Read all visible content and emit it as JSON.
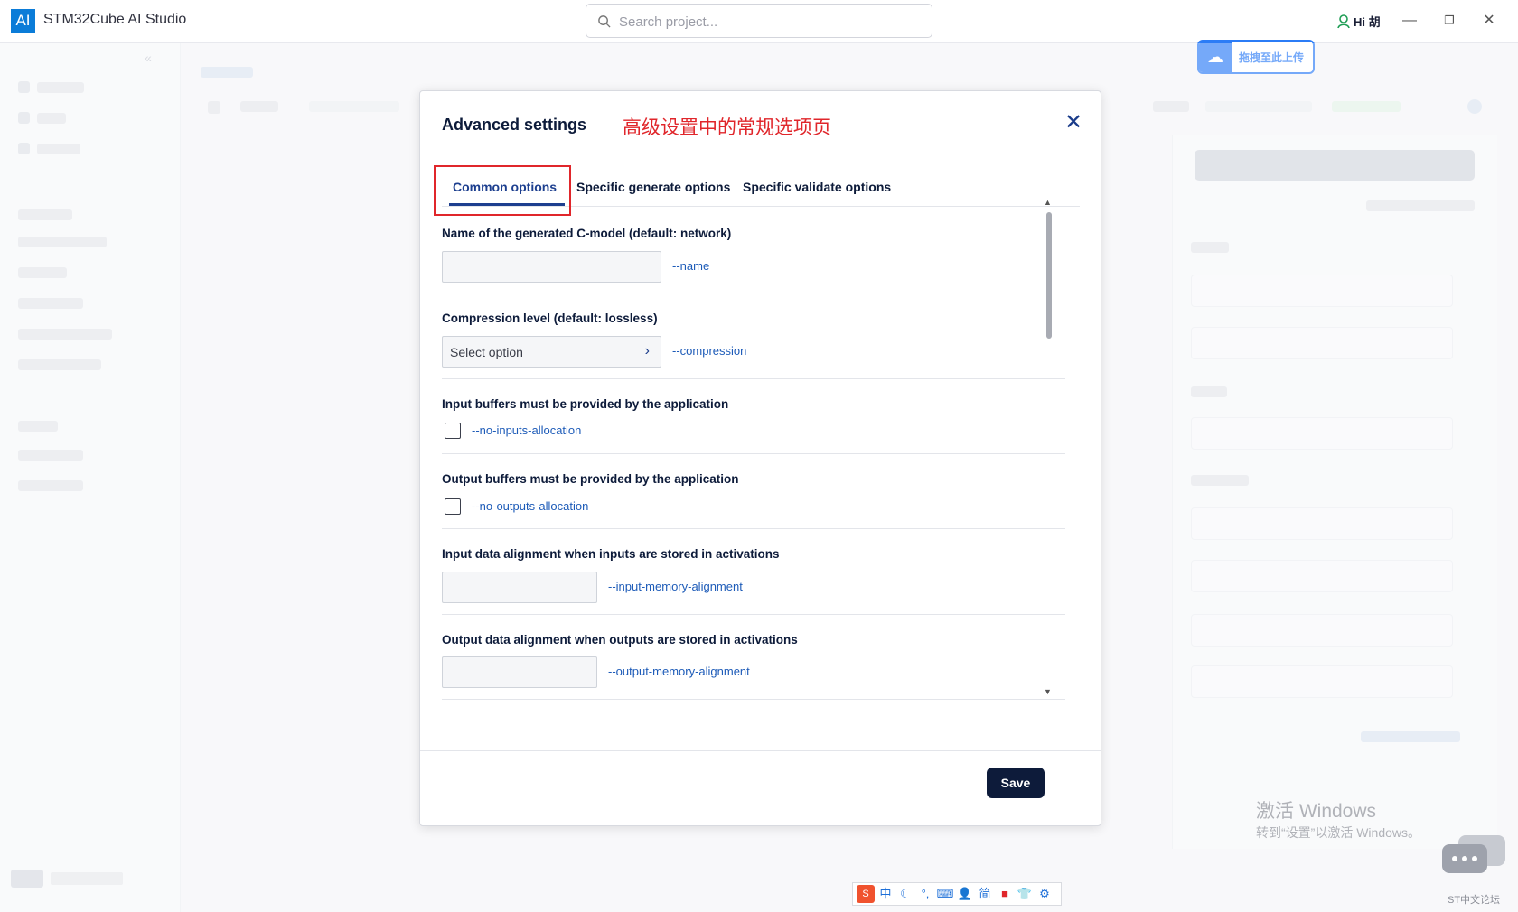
{
  "app": {
    "logo_text": "AI",
    "title": "STM32Cube AI Studio",
    "search_placeholder": "Search project...",
    "user_greeting": "Hi 胡",
    "upload_badge": "拖拽至此上传"
  },
  "modal": {
    "title": "Advanced settings",
    "annotation": "高级设置中的常规选项页",
    "close_symbol": "✕",
    "tabs": [
      {
        "label": "Common options",
        "active": true
      },
      {
        "label": "Specific generate options",
        "active": false
      },
      {
        "label": "Specific validate options",
        "active": false
      }
    ],
    "sections": [
      {
        "label": "Name of the generated C-model (default: network)",
        "type": "text",
        "value": "",
        "flag": "--name"
      },
      {
        "label": "Compression level (default: lossless)",
        "type": "select",
        "value": "Select option",
        "flag": "--compression"
      },
      {
        "label": "Input buffers must be provided by the application",
        "type": "checkbox",
        "checked": false,
        "flag": "--no-inputs-allocation"
      },
      {
        "label": "Output buffers must be provided by the application",
        "type": "checkbox",
        "checked": false,
        "flag": "--no-outputs-allocation"
      },
      {
        "label": "Input data alignment when inputs are stored in activations",
        "type": "text",
        "value": "",
        "flag": "--input-memory-alignment"
      },
      {
        "label": "Output data alignment when outputs are stored in activations",
        "type": "text",
        "value": "",
        "flag": "--output-memory-alignment"
      }
    ],
    "save_label": "Save"
  },
  "watermark": {
    "title": "激活 Windows",
    "subtitle": "转到“设置”以激活 Windows。",
    "forum_label": "ST中文论坛"
  },
  "ime": {
    "mode_label": "中",
    "script_label": "简"
  },
  "colors": {
    "accent": "#1d3f8f",
    "annotation_red": "#e0262b",
    "primary_button": "#0d1b3a",
    "flag_link": "#1d5bb8"
  }
}
